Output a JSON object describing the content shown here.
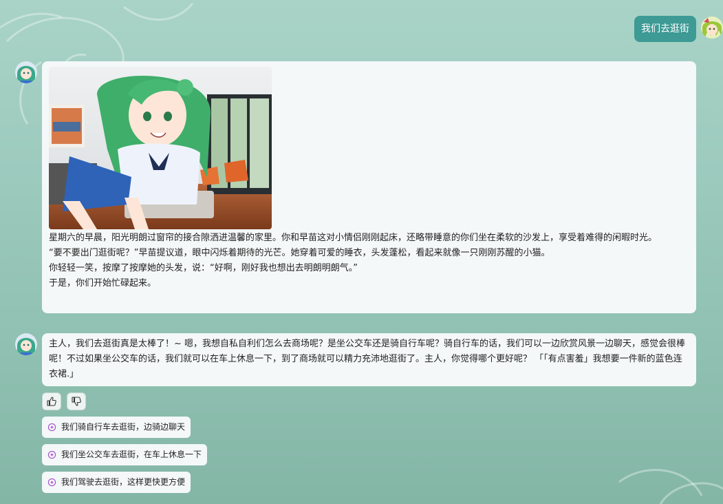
{
  "user_message": {
    "text": "我们去逛街"
  },
  "bot_message_1": {
    "paragraphs": [
      "星期六的早晨，阳光明朗过窗帘的接合隙洒进温馨的家里。你和早苗这对小情侣刚刚起床，还略带睡意的你们坐在柔软的沙发上，享受着难得的闲暇时光。",
      "“要不要出门逛街呢？”早苗提议道，眼中闪烁着期待的光芒。她穿着可爱的睡衣，头发蓬松，看起来就像一只刚刚苏醒的小猫。",
      "你轻轻一笑，按摩了按摩她的头发，说：“好啊，刚好我也想出去明朗明朗气。”",
      "于是，你们开始忙碌起来。"
    ]
  },
  "bot_message_2": {
    "text": "主人，我们去逛街真是太棒了！~ 嗯，我想自私自利们怎么去商场呢？是坐公交车还是骑自行车呢？骑自行车的话，我们可以一边欣赏风景一边聊天，感觉会很棒呢！不过如果坐公交车的话，我们就可以在车上休息一下，到了商场就可以精力充沛地逛街了。主人，你觉得哪个更好呢？ 「「有点害羞」我想要一件新的蓝色连衣裙.」"
  },
  "feedback": {
    "like_icon": "thumbs-up-icon",
    "dislike_icon": "thumbs-down-icon"
  },
  "suggestions": [
    "我们骑自行车去逛街，边骑边聊天",
    "我们坐公交车去逛街，在车上休息一下",
    "我们驾驶去逛街，这样更快更方便"
  ],
  "colors": {
    "user_bubble": "#3d9a94",
    "bubble_bg": "#f4f8f8",
    "suggestion_icon": "#a64bd0"
  }
}
